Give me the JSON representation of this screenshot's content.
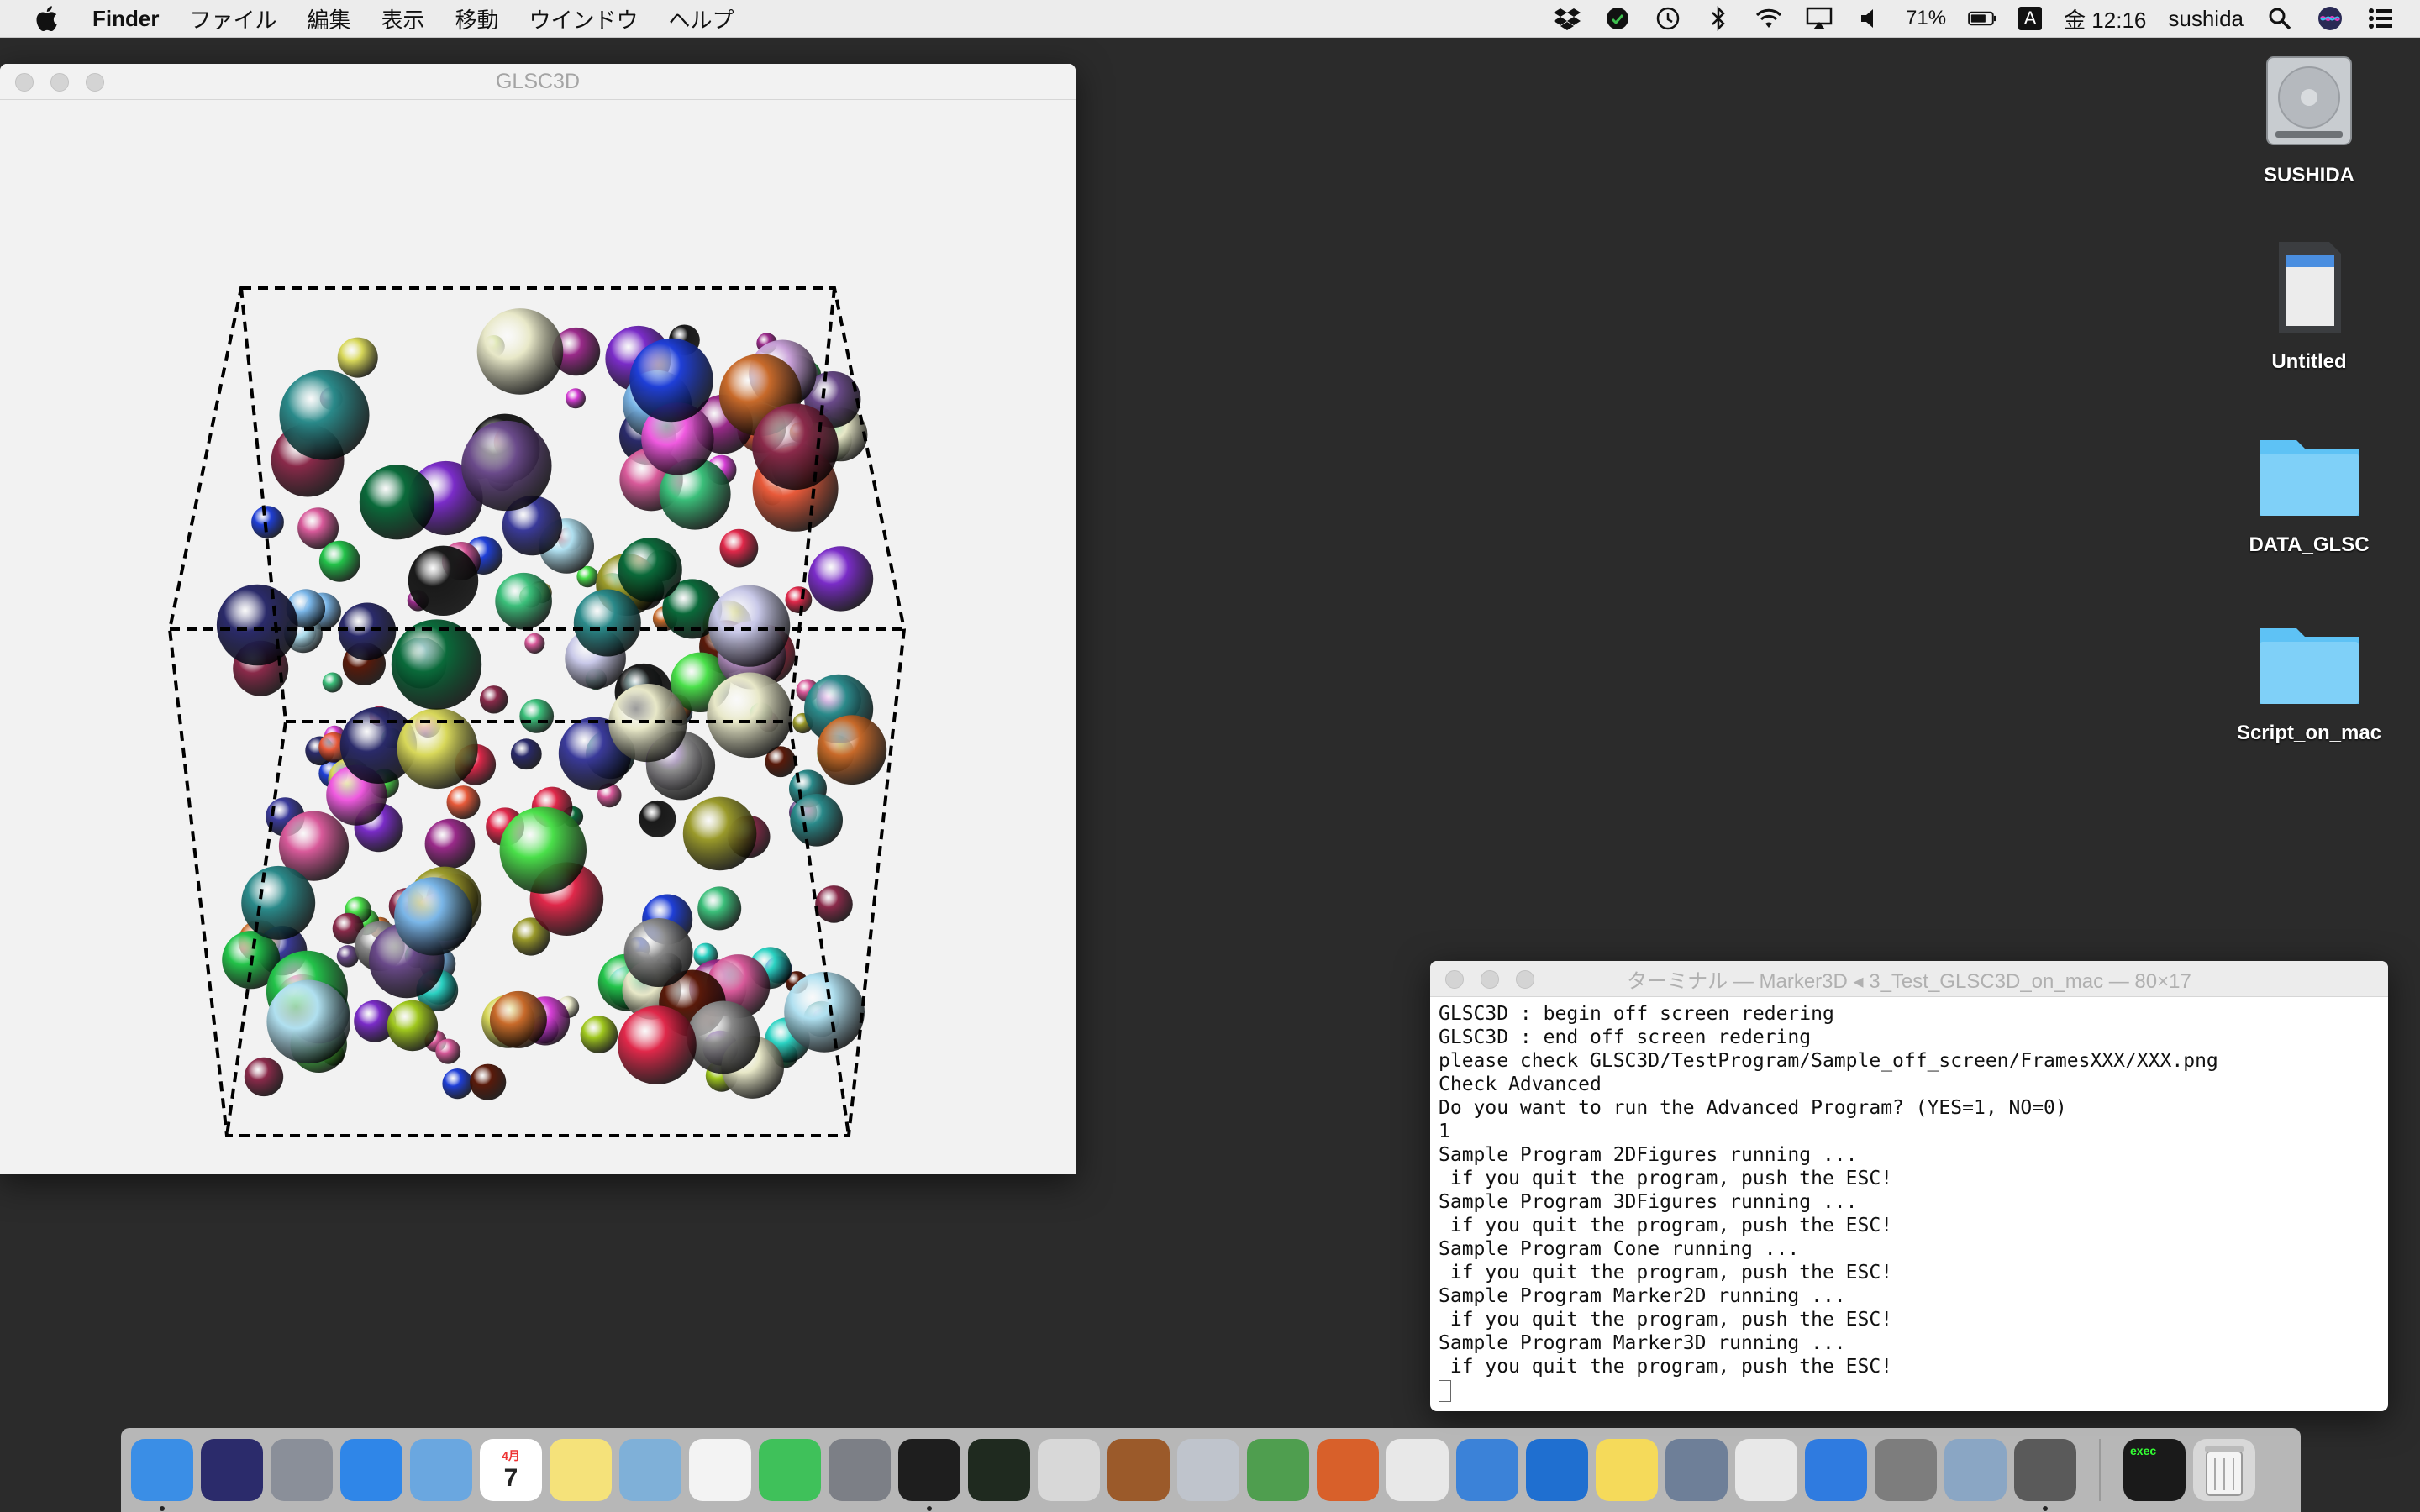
{
  "menubar": {
    "app_name": "Finder",
    "items": [
      "ファイル",
      "編集",
      "表示",
      "移動",
      "ウインドウ",
      "ヘルプ"
    ],
    "battery": "71%",
    "input_mode": "A",
    "clock": "金 12:16",
    "user": "sushida"
  },
  "desktop": {
    "icons": [
      {
        "label": "SUSHIDA",
        "kind": "hard-drive"
      },
      {
        "label": "Untitled",
        "kind": "sd-card"
      },
      {
        "label": "DATA_GLSC",
        "kind": "folder"
      },
      {
        "label": "Script_on_mac",
        "kind": "folder"
      }
    ]
  },
  "glsc_window": {
    "title": "GLSC3D"
  },
  "terminal": {
    "title": "ターミナル — Marker3D ◂ 3_Test_GLSC3D_on_mac — 80×17",
    "lines": [
      "GLSC3D : begin off screen redering",
      "GLSC3D : end off screen redering",
      "please check GLSC3D/TestProgram/Sample_off_screen/FramesXXX/XXX.png",
      "Check Advanced",
      "Do you want to run the Advanced Program? (YES=1, NO=0)",
      "1",
      "Sample Program 2DFigures running ...",
      " if you quit the program, push the ESC!",
      "Sample Program 3DFigures running ...",
      " if you quit the program, push the ESC!",
      "Sample Program Cone running ...",
      " if you quit the program, push the ESC!",
      "Sample Program Marker2D running ...",
      " if you quit the program, push the ESC!",
      "Sample Program Marker3D running ...",
      " if you quit the program, push the ESC!"
    ]
  },
  "dock": {
    "apps": [
      {
        "name": "finder-icon",
        "color": "#3a8ee6",
        "running": true
      },
      {
        "name": "siri-icon",
        "color": "#2b2b6b",
        "running": false
      },
      {
        "name": "launchpad-icon",
        "color": "#8a8f99",
        "running": false
      },
      {
        "name": "safari-icon",
        "color": "#2f86e8",
        "running": false
      },
      {
        "name": "mail-icon",
        "color": "#6aa7e0",
        "running": false
      },
      {
        "name": "calendar-icon",
        "color": "#ffffff",
        "running": false
      },
      {
        "name": "notes-icon",
        "color": "#f5e27a",
        "running": false
      },
      {
        "name": "preview-icon",
        "color": "#7fb0d8",
        "running": false
      },
      {
        "name": "photos-icon",
        "color": "#f3f3f3",
        "running": false
      },
      {
        "name": "facetime-icon",
        "color": "#3fc15a",
        "running": false
      },
      {
        "name": "system-preferences-icon",
        "color": "#7c7f86",
        "running": false
      },
      {
        "name": "terminal-icon",
        "color": "#1e1e1e",
        "running": true
      },
      {
        "name": "activity-monitor-icon",
        "color": "#1f2a1f",
        "running": false
      },
      {
        "name": "x11-icon",
        "color": "#d8d8d8",
        "running": false
      },
      {
        "name": "keynote-icon",
        "color": "#9b5a2a",
        "running": false
      },
      {
        "name": "script-editor-icon",
        "color": "#bfc4cc",
        "running": false
      },
      {
        "name": "numbers-icon",
        "color": "#4f9e4f",
        "running": false
      },
      {
        "name": "mathematica-icon",
        "color": "#d8602a",
        "running": false
      },
      {
        "name": "latexit-icon",
        "color": "#e8e8e8",
        "running": false
      },
      {
        "name": "keynote-remote-icon",
        "color": "#3b82d8",
        "running": false
      },
      {
        "name": "quicktime-icon",
        "color": "#1f6fd0",
        "running": false
      },
      {
        "name": "stickies-icon",
        "color": "#f5da5a",
        "running": false
      },
      {
        "name": "tex-icon",
        "color": "#6e7f98",
        "running": false
      },
      {
        "name": "chrome-icon",
        "color": "#e8e8e8",
        "running": false
      },
      {
        "name": "xcode-icon",
        "color": "#2f7be0",
        "running": false
      },
      {
        "name": "gimp-icon",
        "color": "#7d7d7d",
        "running": false
      },
      {
        "name": "image-capture-icon",
        "color": "#8aa6c4",
        "running": false
      },
      {
        "name": "skim-icon",
        "color": "#5a5a5a",
        "running": true
      },
      {
        "name": "exec-terminal-icon",
        "color": "#1a1a1a",
        "running": false
      }
    ],
    "exec_label": "exec",
    "calendar_day": "7",
    "calendar_month": "4月"
  },
  "colors": {
    "desktop_bg": "#2b2b2b",
    "window_bg": "#f2f2f2",
    "folder_blue": "#5ec2f5"
  }
}
